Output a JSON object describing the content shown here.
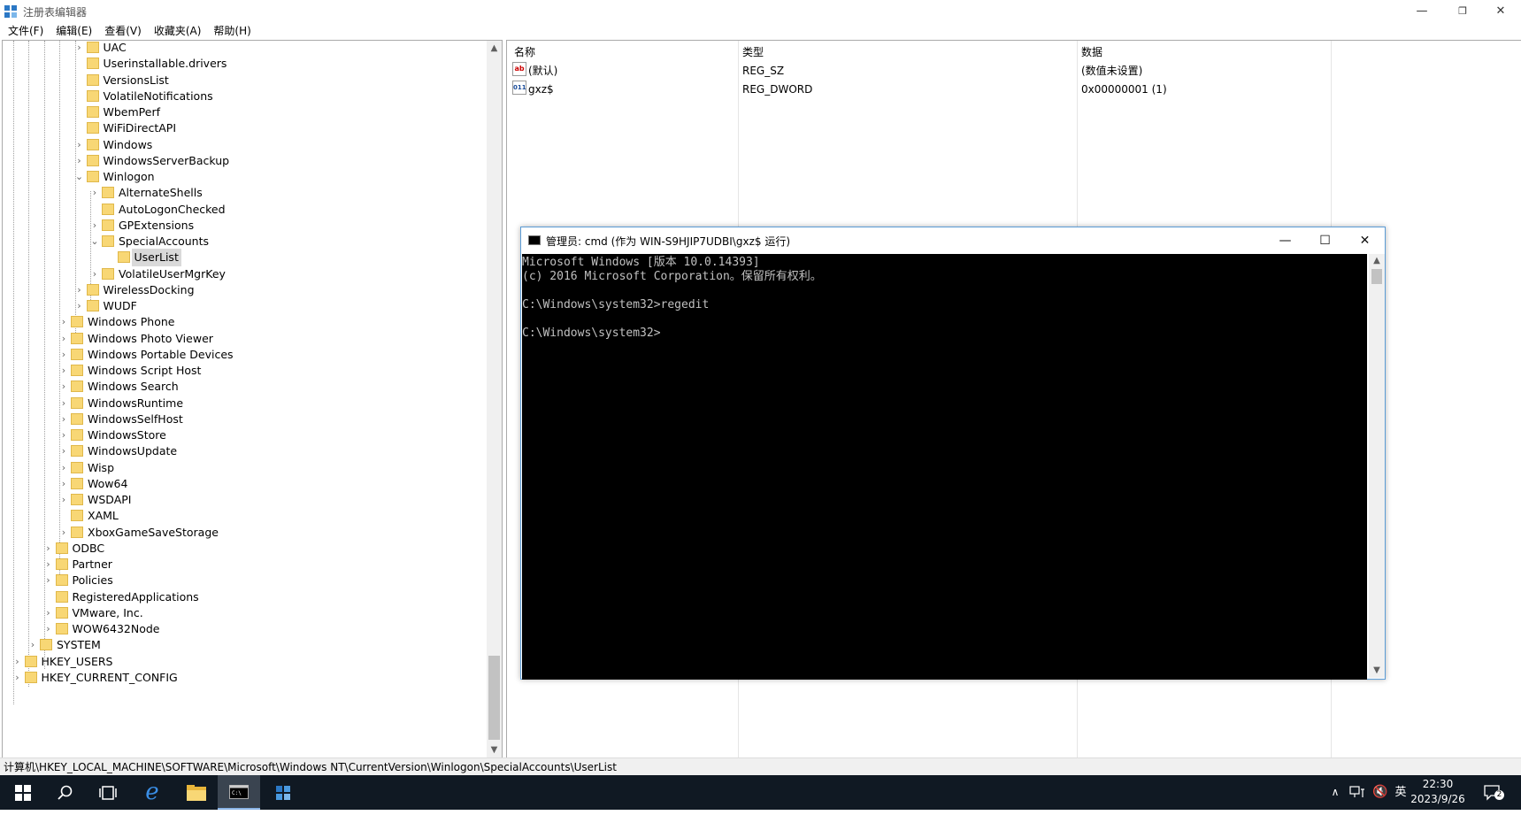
{
  "window": {
    "title": "注册表编辑器",
    "minimize": "—",
    "restore": "❐",
    "close": "✕"
  },
  "menu": [
    "文件(F)",
    "编辑(E)",
    "查看(V)",
    "收藏夹(A)",
    "帮助(H)"
  ],
  "tree": [
    {
      "label": "UAC",
      "level": 5,
      "expander": "›"
    },
    {
      "label": "Userinstallable.drivers",
      "level": 5,
      "expander": ""
    },
    {
      "label": "VersionsList",
      "level": 5,
      "expander": ""
    },
    {
      "label": "VolatileNotifications",
      "level": 5,
      "expander": ""
    },
    {
      "label": "WbemPerf",
      "level": 5,
      "expander": ""
    },
    {
      "label": "WiFiDirectAPI",
      "level": 5,
      "expander": ""
    },
    {
      "label": "Windows",
      "level": 5,
      "expander": "›"
    },
    {
      "label": "WindowsServerBackup",
      "level": 5,
      "expander": "›"
    },
    {
      "label": "Winlogon",
      "level": 5,
      "expander": "⌄"
    },
    {
      "label": "AlternateShells",
      "level": 6,
      "expander": "›"
    },
    {
      "label": "AutoLogonChecked",
      "level": 6,
      "expander": ""
    },
    {
      "label": "GPExtensions",
      "level": 6,
      "expander": "›"
    },
    {
      "label": "SpecialAccounts",
      "level": 6,
      "expander": "⌄"
    },
    {
      "label": "UserList",
      "level": 7,
      "expander": "",
      "selected": true
    },
    {
      "label": "VolatileUserMgrKey",
      "level": 6,
      "expander": "›"
    },
    {
      "label": "WirelessDocking",
      "level": 5,
      "expander": "›"
    },
    {
      "label": "WUDF",
      "level": 5,
      "expander": "›"
    },
    {
      "label": "Windows Phone",
      "level": 4,
      "expander": "›"
    },
    {
      "label": "Windows Photo Viewer",
      "level": 4,
      "expander": "›"
    },
    {
      "label": "Windows Portable Devices",
      "level": 4,
      "expander": "›"
    },
    {
      "label": "Windows Script Host",
      "level": 4,
      "expander": "›"
    },
    {
      "label": "Windows Search",
      "level": 4,
      "expander": "›"
    },
    {
      "label": "WindowsRuntime",
      "level": 4,
      "expander": "›"
    },
    {
      "label": "WindowsSelfHost",
      "level": 4,
      "expander": "›"
    },
    {
      "label": "WindowsStore",
      "level": 4,
      "expander": "›"
    },
    {
      "label": "WindowsUpdate",
      "level": 4,
      "expander": "›"
    },
    {
      "label": "Wisp",
      "level": 4,
      "expander": "›"
    },
    {
      "label": "Wow64",
      "level": 4,
      "expander": "›"
    },
    {
      "label": "WSDAPI",
      "level": 4,
      "expander": "›"
    },
    {
      "label": "XAML",
      "level": 4,
      "expander": ""
    },
    {
      "label": "XboxGameSaveStorage",
      "level": 4,
      "expander": "›"
    },
    {
      "label": "ODBC",
      "level": 3,
      "expander": "›"
    },
    {
      "label": "Partner",
      "level": 3,
      "expander": "›"
    },
    {
      "label": "Policies",
      "level": 3,
      "expander": "›"
    },
    {
      "label": "RegisteredApplications",
      "level": 3,
      "expander": ""
    },
    {
      "label": "VMware, Inc.",
      "level": 3,
      "expander": "›"
    },
    {
      "label": "WOW6432Node",
      "level": 3,
      "expander": "›"
    },
    {
      "label": "SYSTEM",
      "level": 2,
      "expander": "›"
    },
    {
      "label": "HKEY_USERS",
      "level": 1,
      "expander": "›"
    },
    {
      "label": "HKEY_CURRENT_CONFIG",
      "level": 1,
      "expander": "›"
    }
  ],
  "values": {
    "headers": {
      "name": "名称",
      "type": "类型",
      "data": "数据"
    },
    "rows": [
      {
        "icon": "ab",
        "icon_name": "string-value-icon",
        "name": "(默认)",
        "type": "REG_SZ",
        "data": "(数值未设置)"
      },
      {
        "icon": "011",
        "icon_name": "binary-value-icon",
        "name": "gxz$",
        "type": "REG_DWORD",
        "data": "0x00000001 (1)"
      }
    ]
  },
  "status": "计算机\\HKEY_LOCAL_MACHINE\\SOFTWARE\\Microsoft\\Windows NT\\CurrentVersion\\Winlogon\\SpecialAccounts\\UserList",
  "cmd": {
    "title": "管理员: cmd (作为 WIN-S9HJIP7UDBI\\gxz$ 运行)",
    "minimize": "—",
    "maximize": "☐",
    "close": "✕",
    "lines": [
      "Microsoft Windows [版本 10.0.14393]",
      "(c) 2016 Microsoft Corporation。保留所有权利。",
      "",
      "C:\\Windows\\system32>regedit",
      "",
      "C:\\Windows\\system32>"
    ]
  },
  "taskbar": {
    "clock_time": "22:30",
    "clock_date": "2023/9/26",
    "ime": "英",
    "notification_count": "2"
  },
  "colors": {
    "taskbar": "#101923",
    "folder": "#f8d775",
    "cmd_border": "#5a9bd5"
  }
}
